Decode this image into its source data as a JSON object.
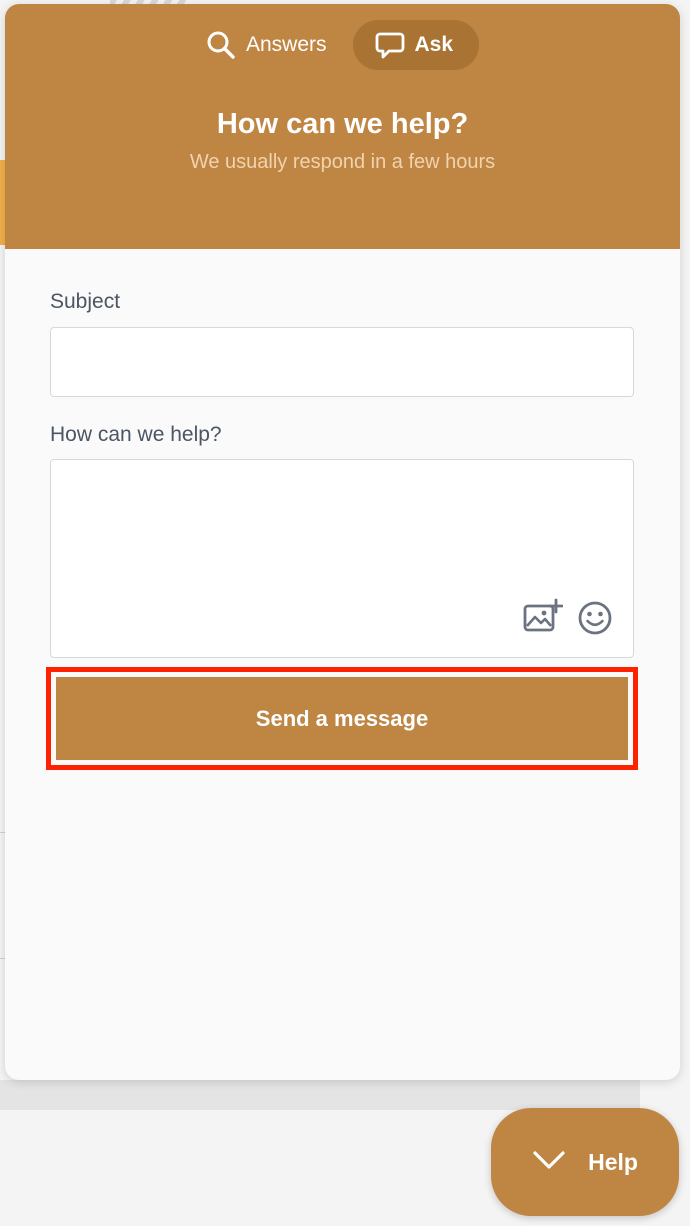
{
  "widget": {
    "tabs": [
      {
        "label": "Answers",
        "icon": "search-icon",
        "active": false
      },
      {
        "label": "Ask",
        "icon": "speech-bubble-icon",
        "active": true
      }
    ],
    "title": "How can we help?",
    "subtitle": "We usually respond in a few hours",
    "form": {
      "subject_label": "Subject",
      "subject_value": "",
      "message_label": "How can we help?",
      "message_value": "",
      "attach_icon": "add-image-icon",
      "emoji_icon": "smiley-icon",
      "send_label": "Send a message"
    }
  },
  "launcher": {
    "label": "Help",
    "icon": "chevron-down-icon"
  },
  "colors": {
    "brand": "#bf8543",
    "brand_dark": "#a87333",
    "subtitle": "#f1d3b0",
    "highlight": "#ff2200"
  }
}
